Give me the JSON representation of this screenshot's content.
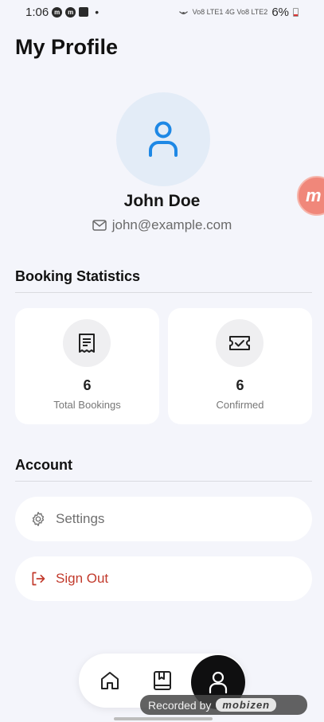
{
  "status_bar": {
    "time": "1:06",
    "dot": "•",
    "network": "Vo8 LTE1 4G Vo8 LTE2",
    "battery": "6%"
  },
  "page": {
    "title": "My Profile"
  },
  "profile": {
    "name": "John Doe",
    "email": "john@example.com"
  },
  "booking_statistics": {
    "heading": "Booking Statistics",
    "cards": [
      {
        "value": "6",
        "label": "Total Bookings",
        "icon": "receipt-icon"
      },
      {
        "value": "6",
        "label": "Confirmed",
        "icon": "ticket-check-icon"
      }
    ]
  },
  "account": {
    "heading": "Account",
    "settings_label": "Settings",
    "signout_label": "Sign Out"
  },
  "bottom_nav": {
    "items": [
      "home-icon",
      "bookings-icon",
      "profile-icon"
    ],
    "active": "profile"
  },
  "recorder": {
    "bubble_letter": "m",
    "banner_text": "Recorded by",
    "banner_brand": "mobizen"
  },
  "colors": {
    "background": "#f4f5fb",
    "accent": "#1e88e5",
    "danger": "#c23a2c"
  }
}
